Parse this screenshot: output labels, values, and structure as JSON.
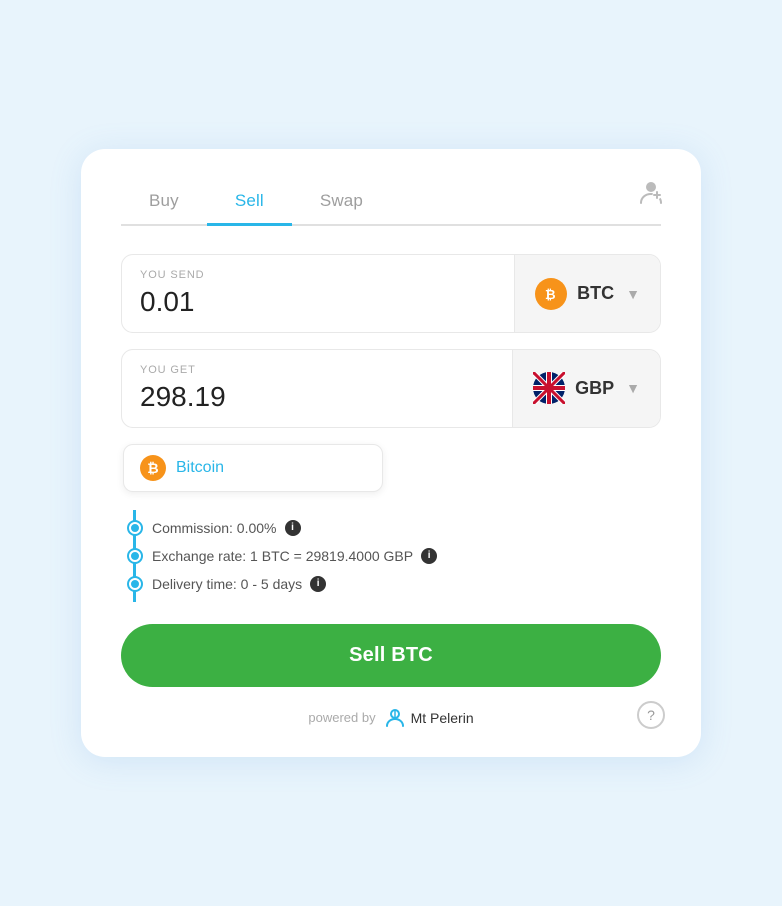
{
  "tabs": [
    {
      "label": "Buy",
      "active": false
    },
    {
      "label": "Sell",
      "active": true
    },
    {
      "label": "Swap",
      "active": false
    }
  ],
  "send": {
    "label": "YOU SEND",
    "value": "0.01",
    "currency": "BTC"
  },
  "receive": {
    "label": "YOU GET",
    "value": "298.19",
    "currency": "GBP"
  },
  "dropdown": {
    "coin": "Bitcoin"
  },
  "info": {
    "commission": "Commission: 0.00%",
    "exchange_rate": "Exchange rate: 1 BTC = 29819.4000 GBP",
    "delivery": "Delivery time: 0 - 5 days"
  },
  "sell_button": "Sell BTC",
  "footer": {
    "powered_by": "powered by",
    "brand": "Mt Pelerin"
  },
  "colors": {
    "active_tab": "#29b6e8",
    "sell_button": "#3cb043",
    "dot": "#29b6e8"
  }
}
